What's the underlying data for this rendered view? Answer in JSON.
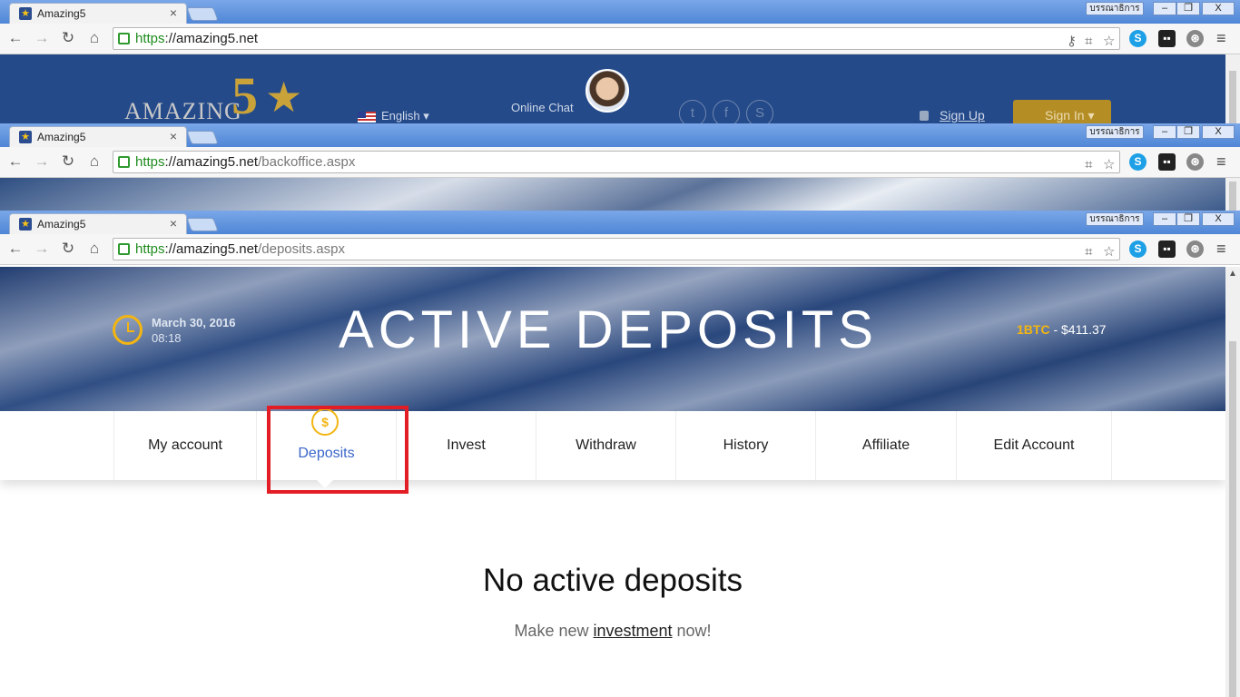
{
  "windows": [
    {
      "tab_title": "Amazing5",
      "url_scheme": "https",
      "url_host": "://amazing5.net",
      "url_path": "",
      "user_button": "บรรณาธิการ"
    },
    {
      "tab_title": "Amazing5",
      "url_scheme": "https",
      "url_host": "://amazing5.net",
      "url_path": "/backoffice.aspx",
      "user_button": "บรรณาธิการ"
    },
    {
      "tab_title": "Amazing5",
      "url_scheme": "https",
      "url_host": "://amazing5.net",
      "url_path": "/deposits.aspx",
      "user_button": "บรรณาธิการ"
    }
  ],
  "window_controls": {
    "minimize": "–",
    "maximize": "❐",
    "close": "X"
  },
  "site_header": {
    "logo_text": "AMAZING",
    "logo_number": "5",
    "language": "English",
    "chat_label": "Online Chat",
    "signup": "Sign Up",
    "signin": "Sign In"
  },
  "hero": {
    "date": "March 30, 2016",
    "time": "08:18",
    "title": "ACTIVE DEPOSITS",
    "btc_label": "1BTC",
    "btc_value": " - $411.37"
  },
  "nav": [
    {
      "label": "My account",
      "active": false
    },
    {
      "label": "Deposits",
      "active": true
    },
    {
      "label": "Invest",
      "active": false
    },
    {
      "label": "Withdraw",
      "active": false
    },
    {
      "label": "History",
      "active": false
    },
    {
      "label": "Affiliate",
      "active": false
    },
    {
      "label": "Edit Account",
      "active": false
    }
  ],
  "main": {
    "title": "No active deposits",
    "sub_before": "Make new ",
    "sub_link": "investment",
    "sub_after": " now!"
  },
  "colors": {
    "accent_gold": "#f2b511",
    "active_blue": "#3a67c9",
    "highlight_red": "#e21d25"
  },
  "icons": {
    "back": "back-arrow-icon",
    "forward": "forward-arrow-icon",
    "reload": "reload-icon",
    "home": "home-icon",
    "star": "bookmark-star-icon",
    "translate": "translate-icon",
    "menu": "hamburger-menu-icon",
    "clock": "clock-icon",
    "dollar": "dollar-coin-icon"
  }
}
